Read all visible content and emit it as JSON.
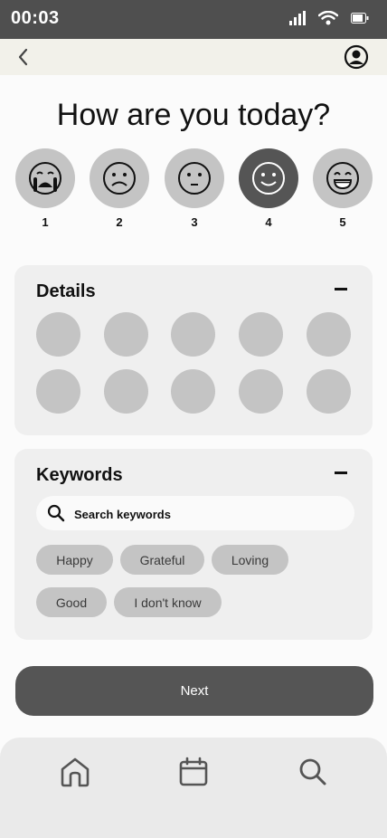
{
  "status_bar": {
    "time": "00:03",
    "icons": [
      "signal-icon",
      "wifi-icon",
      "battery-icon"
    ]
  },
  "top_bar": {
    "back_icon": "chevron-left-icon",
    "profile_icon": "user-profile-icon"
  },
  "question": "How are you today?",
  "moods": [
    {
      "label": "1",
      "icon": "crying-face-icon",
      "selected": false
    },
    {
      "label": "2",
      "icon": "frowning-face-icon",
      "selected": false
    },
    {
      "label": "3",
      "icon": "neutral-face-icon",
      "selected": false
    },
    {
      "label": "4",
      "icon": "smiling-face-icon",
      "selected": true
    },
    {
      "label": "5",
      "icon": "grinning-face-icon",
      "selected": false
    }
  ],
  "details": {
    "title": "Details",
    "option_count": 10
  },
  "keywords": {
    "title": "Keywords",
    "search_placeholder": "Search keywords",
    "chips": [
      "Happy",
      "Grateful",
      "Loving",
      "Good",
      "I don't know"
    ]
  },
  "next_label": "Next",
  "bottom_nav": {
    "items": [
      "home-icon",
      "calendar-icon",
      "search-icon"
    ]
  },
  "colors": {
    "status_bar": "#4f4f4f",
    "top_bar": "#f2f1ea",
    "selected_mood": "#555555",
    "unselected": "#c4c4c4",
    "card": "#efefef",
    "button": "#555555"
  }
}
